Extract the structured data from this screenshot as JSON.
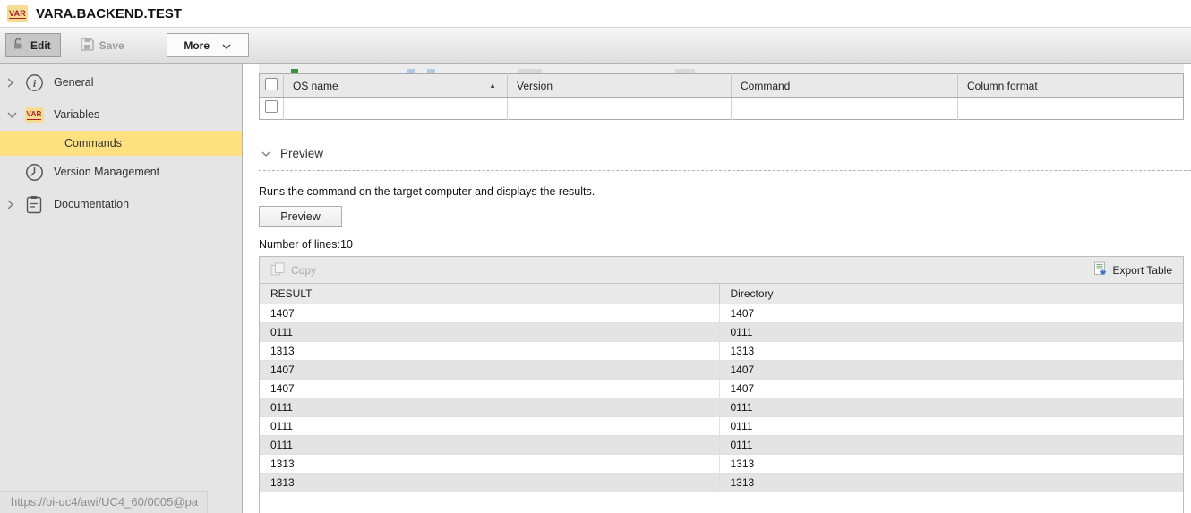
{
  "window": {
    "title": "VARA.BACKEND.TEST",
    "object_type_badge": "VAR",
    "status_url": "https://bi-uc4/awi/UC4_60/0005@pa"
  },
  "toolbar": {
    "edit_label": "Edit",
    "save_label": "Save",
    "more_label": "More"
  },
  "sidebar": {
    "items": [
      {
        "label": "General",
        "icon": "info-icon",
        "expander": "collapsed"
      },
      {
        "label": "Variables",
        "icon": "var-badge-icon",
        "expander": "expanded"
      },
      {
        "label": "Commands",
        "icon": "none",
        "state": "selected"
      },
      {
        "label": "Version Management",
        "icon": "clock-icon",
        "expander": "none"
      },
      {
        "label": "Documentation",
        "icon": "clipboard-icon",
        "expander": "collapsed"
      }
    ]
  },
  "commands_table": {
    "columns": [
      "OS name",
      "Version",
      "Command",
      "Column format"
    ],
    "sort_column": "OS name",
    "sort_direction": "ascending",
    "rows": [
      {
        "os_name": "",
        "version": "",
        "command": "",
        "column_format": ""
      }
    ]
  },
  "preview_section": {
    "title": "Preview",
    "description": "Runs the command on the target computer and displays the results.",
    "preview_button_label": "Preview",
    "number_of_lines": "Number of lines:10"
  },
  "results": {
    "copy_label": "Copy",
    "export_label": "Export Table",
    "columns": [
      "RESULT",
      "Directory"
    ],
    "rows": [
      [
        "1407",
        "1407"
      ],
      [
        "0111",
        "0111"
      ],
      [
        "1313",
        "1313"
      ],
      [
        "1407",
        "1407"
      ],
      [
        "1407",
        "1407"
      ],
      [
        "0111",
        "0111"
      ],
      [
        "0111",
        "0111"
      ],
      [
        "0111",
        "0111"
      ],
      [
        "1313",
        "1313"
      ],
      [
        "1313",
        "1313"
      ]
    ]
  },
  "colors": {
    "selected_row_highlight": "#fde180",
    "badge_bg": "#f6dc91",
    "badge_text": "#a32032",
    "alt_row": "#e4e4e4",
    "toolbar_bg": "#e9e9e9"
  }
}
